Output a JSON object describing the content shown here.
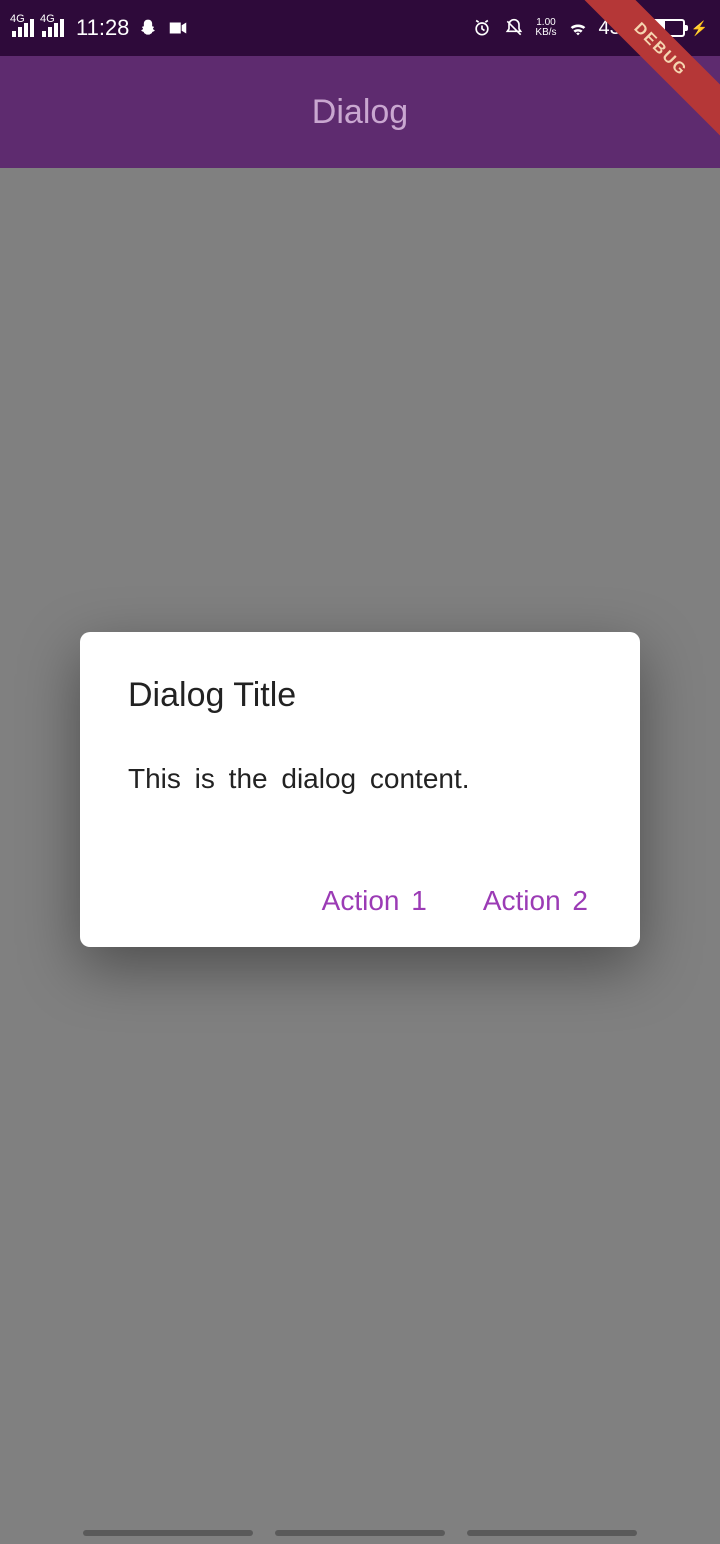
{
  "statusBar": {
    "signal1": "4G",
    "signal2": "4G",
    "time": "11:28",
    "kbsTop": "1.00",
    "kbsBottom": "KB/s",
    "batteryPercent": "43%"
  },
  "appBar": {
    "title": "Dialog"
  },
  "debug": {
    "label": "DEBUG"
  },
  "dialog": {
    "title": "Dialog Title",
    "content": "This is the dialog content.",
    "action1": "Action 1",
    "action2": "Action 2"
  }
}
